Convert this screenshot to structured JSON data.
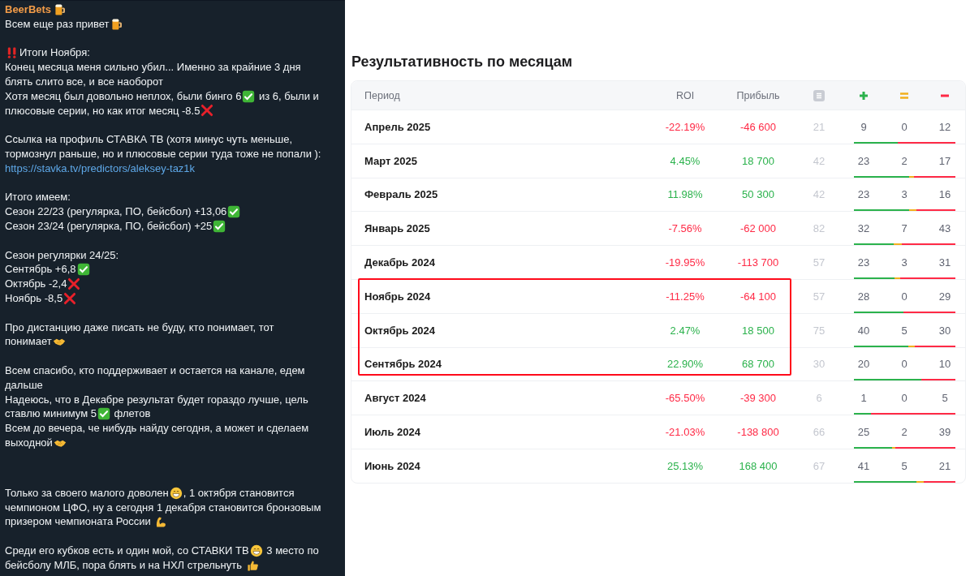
{
  "chat": {
    "author": "BeerBets",
    "paragraphs": [
      [
        [
          {
            "kind": "text",
            "text": "Всем еще раз привет"
          },
          {
            "kind": "beer"
          }
        ]
      ],
      [
        [
          {
            "kind": "bangbang"
          },
          {
            "kind": "text",
            "text": "Итоги Ноября:"
          }
        ],
        [
          {
            "kind": "text",
            "text": "Конец месяца меня сильно убил... Именно за крайние 3 дня"
          }
        ],
        [
          {
            "kind": "text",
            "text": "блять слито все, и все наоборот"
          }
        ],
        [
          {
            "kind": "text",
            "text": "Хотя месяц был довольно неплох, были бинго 6"
          },
          {
            "kind": "check"
          },
          {
            "kind": "text",
            "text": " из 6, были и"
          }
        ],
        [
          {
            "kind": "text",
            "text": "плюсовые серии, но как итог месяц -8.5"
          },
          {
            "kind": "cross"
          }
        ]
      ],
      [
        [
          {
            "kind": "text",
            "text": "Ссылка на профиль СТАВКА ТВ (хотя минус чуть меньше,"
          }
        ],
        [
          {
            "kind": "text",
            "text": "тормознул раньше, но и плюсовые серии туда тоже не попали ):"
          }
        ],
        [
          {
            "kind": "link",
            "text": "https://stavka.tv/predictors/aleksey-taz1k"
          }
        ]
      ],
      [
        [
          {
            "kind": "text",
            "text": "Итого имеем:"
          }
        ],
        [
          {
            "kind": "text",
            "text": "Сезон 22/23 (регулярка, ПО, бейсбол) +13,06"
          },
          {
            "kind": "check"
          }
        ],
        [
          {
            "kind": "text",
            "text": "Сезон 23/24 (регулярка, ПО, бейсбол) +25"
          },
          {
            "kind": "check"
          }
        ]
      ],
      [
        [
          {
            "kind": "text",
            "text": "Сезон регулярки 24/25:"
          }
        ],
        [
          {
            "kind": "text",
            "text": "Сентябрь +6,8"
          },
          {
            "kind": "check"
          }
        ],
        [
          {
            "kind": "text",
            "text": "Октябрь -2,4"
          },
          {
            "kind": "cross"
          }
        ],
        [
          {
            "kind": "text",
            "text": "Ноябрь -8,5"
          },
          {
            "kind": "cross"
          }
        ]
      ],
      [
        [
          {
            "kind": "text",
            "text": "Про дистанцию даже писать не буду, кто понимает, тот"
          }
        ],
        [
          {
            "kind": "text",
            "text": "понимает"
          },
          {
            "kind": "handshake"
          }
        ]
      ],
      [
        [
          {
            "kind": "text",
            "text": "Всем спасибо, кто поддерживает и остается на канале, едем"
          }
        ],
        [
          {
            "kind": "text",
            "text": "дальше"
          }
        ],
        [
          {
            "kind": "text",
            "text": "Надеюсь, что в Декабре результат будет гораздо лучше, цель"
          }
        ],
        [
          {
            "kind": "text",
            "text": "ставлю минимум 5"
          },
          {
            "kind": "check"
          },
          {
            "kind": "text",
            "text": " флетов"
          }
        ],
        [
          {
            "kind": "text",
            "text": "Всем до вечера, че нибудь найду сегодня, а может и сделаем"
          }
        ],
        [
          {
            "kind": "text",
            "text": "выходной"
          },
          {
            "kind": "handshake"
          }
        ]
      ],
      [
        [
          {
            "kind": "text",
            "text": "Только за своего малого доволен"
          },
          {
            "kind": "grin"
          },
          {
            "kind": "text",
            "text": ", 1 октября становится"
          }
        ],
        [
          {
            "kind": "text",
            "text": "чемпионом ЦФО, ну а сегодня 1 декабря становится бронзовым"
          }
        ],
        [
          {
            "kind": "text",
            "text": "призером чемпионата России "
          },
          {
            "kind": "muscle"
          }
        ]
      ],
      [
        [
          {
            "kind": "text",
            "text": "Среди его кубков есть и один мой, со СТАВКИ ТВ"
          },
          {
            "kind": "grin"
          },
          {
            "kind": "text",
            "text": " 3 место по"
          }
        ],
        [
          {
            "kind": "text",
            "text": "бейсболу МЛБ, пора блять и на НХЛ стрельнуть "
          },
          {
            "kind": "thumbsup"
          }
        ]
      ]
    ]
  },
  "stats": {
    "title": "Результативность по месяцам",
    "columns": [
      "Период",
      "ROI",
      "Прибыль"
    ],
    "rows": [
      {
        "period": "Апрель 2025",
        "roi": "-22.19%",
        "profit": "-46 600",
        "positive": false,
        "total": "21",
        "wins": "9",
        "draws": "0",
        "losses": "12",
        "highlighted": false
      },
      {
        "period": "Март 2025",
        "roi": "4.45%",
        "profit": "18 700",
        "positive": true,
        "total": "42",
        "wins": "23",
        "draws": "2",
        "losses": "17",
        "highlighted": false
      },
      {
        "period": "Февраль 2025",
        "roi": "11.98%",
        "profit": "50 300",
        "positive": true,
        "total": "42",
        "wins": "23",
        "draws": "3",
        "losses": "16",
        "highlighted": false
      },
      {
        "period": "Январь 2025",
        "roi": "-7.56%",
        "profit": "-62 000",
        "positive": false,
        "total": "82",
        "wins": "32",
        "draws": "7",
        "losses": "43",
        "highlighted": false
      },
      {
        "period": "Декабрь 2024",
        "roi": "-19.95%",
        "profit": "-113 700",
        "positive": false,
        "total": "57",
        "wins": "23",
        "draws": "3",
        "losses": "31",
        "highlighted": false
      },
      {
        "period": "Ноябрь 2024",
        "roi": "-11.25%",
        "profit": "-64 100",
        "positive": false,
        "total": "57",
        "wins": "28",
        "draws": "0",
        "losses": "29",
        "highlighted": true
      },
      {
        "period": "Октябрь 2024",
        "roi": "2.47%",
        "profit": "18 500",
        "positive": true,
        "total": "75",
        "wins": "40",
        "draws": "5",
        "losses": "30",
        "highlighted": true
      },
      {
        "period": "Сентябрь 2024",
        "roi": "22.90%",
        "profit": "68 700",
        "positive": true,
        "total": "30",
        "wins": "20",
        "draws": "0",
        "losses": "10",
        "highlighted": true
      },
      {
        "period": "Август 2024",
        "roi": "-65.50%",
        "profit": "-39 300",
        "positive": false,
        "total": "6",
        "wins": "1",
        "draws": "0",
        "losses": "5",
        "highlighted": false
      },
      {
        "period": "Июль 2024",
        "roi": "-21.03%",
        "profit": "-138 800",
        "positive": false,
        "total": "66",
        "wins": "25",
        "draws": "2",
        "losses": "39",
        "highlighted": false
      },
      {
        "period": "Июнь 2024",
        "roi": "25.13%",
        "profit": "168 400",
        "positive": true,
        "total": "67",
        "wins": "41",
        "draws": "5",
        "losses": "21",
        "highlighted": false
      }
    ]
  }
}
